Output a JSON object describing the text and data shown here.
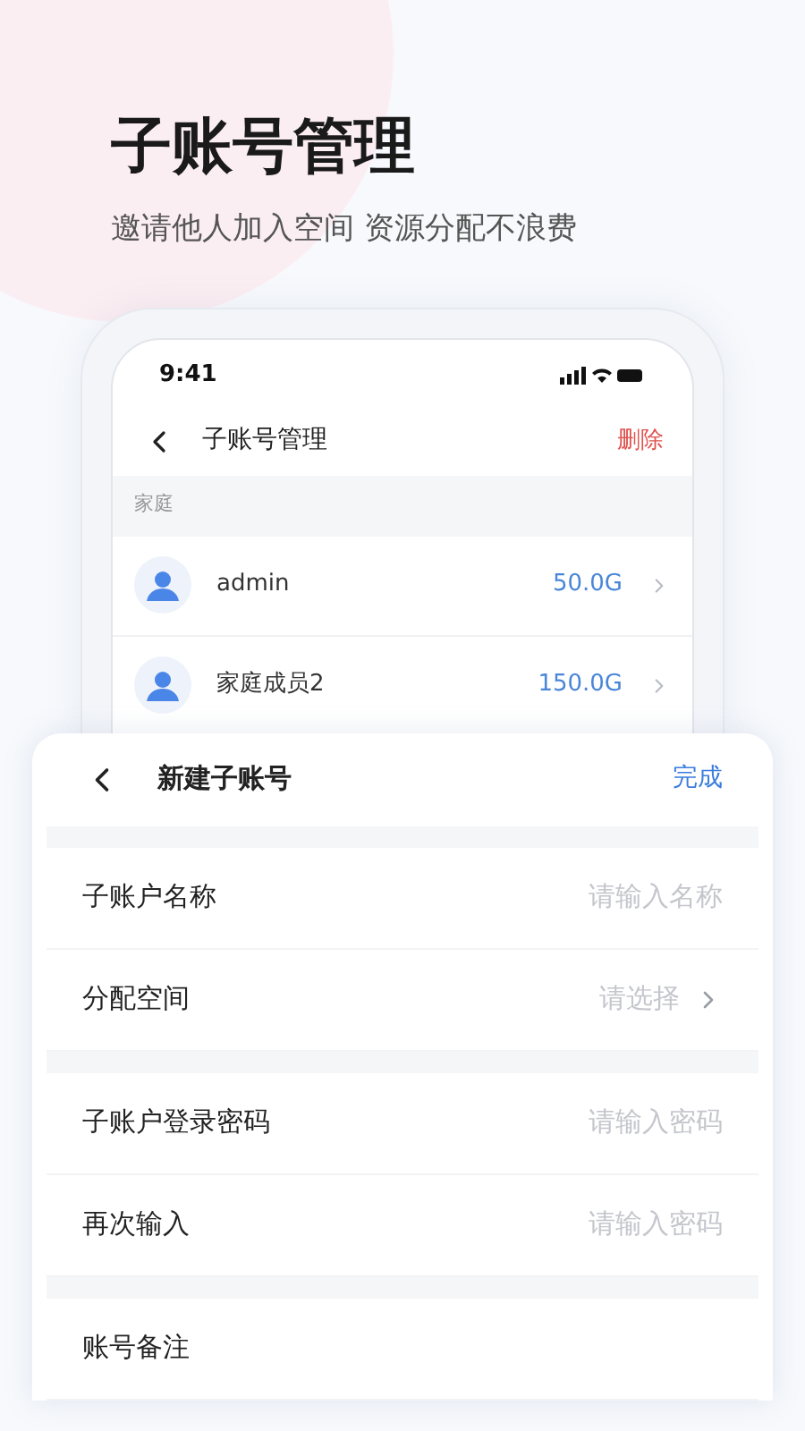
{
  "hero": {
    "title": "子账号管理",
    "subtitle": "邀请他人加入空间 资源分配不浪费"
  },
  "phone": {
    "status_bar": {
      "time": "9:41"
    },
    "nav": {
      "title": "子账号管理",
      "action": "删除"
    },
    "section": "家庭",
    "accounts": [
      {
        "name": "admin",
        "quota": "50.0G"
      },
      {
        "name": "家庭成员2",
        "quota": "150.0G"
      }
    ]
  },
  "sheet": {
    "title": "新建子账号",
    "action": "完成",
    "groups": [
      [
        {
          "kind": "input",
          "label": "子账户名称",
          "placeholder": "请输入名称"
        },
        {
          "kind": "select",
          "label": "分配空间",
          "placeholder": "请选择"
        }
      ],
      [
        {
          "kind": "input",
          "label": "子账户登录密码",
          "placeholder": "请输入密码"
        },
        {
          "kind": "input",
          "label": "再次输入",
          "placeholder": "请输入密码"
        }
      ],
      [
        {
          "kind": "input",
          "label": "账号备注"
        }
      ]
    ]
  }
}
